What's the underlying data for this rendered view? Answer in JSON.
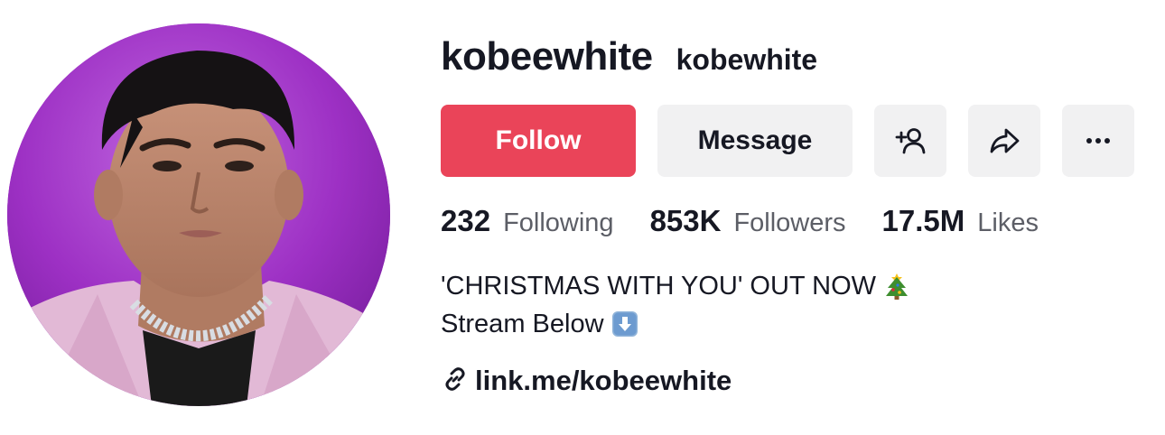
{
  "profile": {
    "username": "kobeewhite",
    "nickname": "kobewhite",
    "avatar_icon": "profile-photo"
  },
  "actions": {
    "follow_label": "Follow",
    "message_label": "Message",
    "add_friend_icon": "add-person-icon",
    "share_icon": "share-icon",
    "more_icon": "more-dots-icon",
    "follow_color": "#ea4459",
    "secondary_color": "#f1f1f2"
  },
  "stats": {
    "following": {
      "count": "232",
      "label": "Following"
    },
    "followers": {
      "count": "853K",
      "label": "Followers"
    },
    "likes": {
      "count": "17.5M",
      "label": "Likes"
    }
  },
  "bio": {
    "line1": "'CHRISTMAS WITH YOU' OUT NOW",
    "line1_emoji": "christmas-tree-icon",
    "line2": "Stream Below",
    "line2_emoji": "down-arrow-icon"
  },
  "link": {
    "text": "link.me/kobeewhite",
    "icon": "link-icon"
  }
}
